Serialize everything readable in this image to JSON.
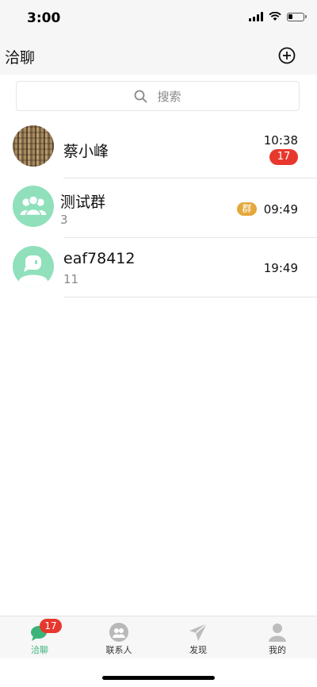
{
  "status_bar": {
    "time": "3:00"
  },
  "nav": {
    "title": "洽聊",
    "add_icon": "plus-circle-icon"
  },
  "search": {
    "placeholder": "搜索",
    "icon": "search-icon"
  },
  "conversations": [
    {
      "name": "蔡小峰",
      "subtitle": "",
      "time": "10:38",
      "unread": "17",
      "tag": "",
      "avatar": "photo-avatar"
    },
    {
      "name": "测试群",
      "subtitle": "3",
      "time": "09:49",
      "unread": "",
      "tag": "群",
      "avatar": "group-avatar-icon"
    },
    {
      "name": "eaf78412",
      "subtitle": "11",
      "time": "19:49",
      "unread": "",
      "tag": "",
      "avatar": "user-avatar-icon"
    }
  ],
  "tabs": [
    {
      "label": "洽聊",
      "badge": "17",
      "active": true,
      "icon": "chat-bubble-icon"
    },
    {
      "label": "联系人",
      "active": false,
      "icon": "contacts-icon"
    },
    {
      "label": "发现",
      "active": false,
      "icon": "paper-plane-icon"
    },
    {
      "label": "我的",
      "active": false,
      "icon": "profile-icon"
    }
  ],
  "colors": {
    "accent": "#3bb47a",
    "badge": "#e8382d",
    "group_tag": "#e4a83c",
    "avatar_green": "#8fe0bb"
  }
}
